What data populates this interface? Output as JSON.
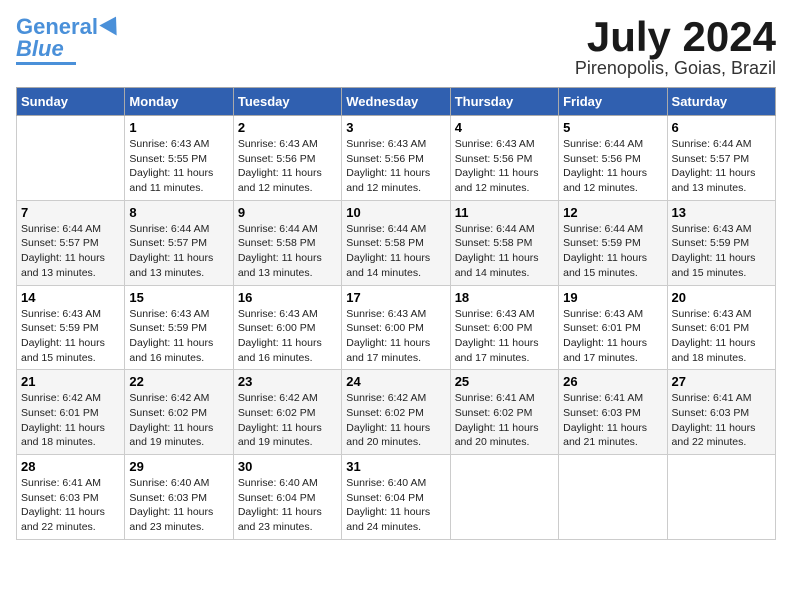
{
  "logo": {
    "line1": "General",
    "line2": "Blue"
  },
  "title": {
    "month": "July 2024",
    "location": "Pirenopolis, Goias, Brazil"
  },
  "weekdays": [
    "Sunday",
    "Monday",
    "Tuesday",
    "Wednesday",
    "Thursday",
    "Friday",
    "Saturday"
  ],
  "weeks": [
    [
      {
        "day": "",
        "info": ""
      },
      {
        "day": "1",
        "info": "Sunrise: 6:43 AM\nSunset: 5:55 PM\nDaylight: 11 hours\nand 11 minutes."
      },
      {
        "day": "2",
        "info": "Sunrise: 6:43 AM\nSunset: 5:56 PM\nDaylight: 11 hours\nand 12 minutes."
      },
      {
        "day": "3",
        "info": "Sunrise: 6:43 AM\nSunset: 5:56 PM\nDaylight: 11 hours\nand 12 minutes."
      },
      {
        "day": "4",
        "info": "Sunrise: 6:43 AM\nSunset: 5:56 PM\nDaylight: 11 hours\nand 12 minutes."
      },
      {
        "day": "5",
        "info": "Sunrise: 6:44 AM\nSunset: 5:56 PM\nDaylight: 11 hours\nand 12 minutes."
      },
      {
        "day": "6",
        "info": "Sunrise: 6:44 AM\nSunset: 5:57 PM\nDaylight: 11 hours\nand 13 minutes."
      }
    ],
    [
      {
        "day": "7",
        "info": "Sunrise: 6:44 AM\nSunset: 5:57 PM\nDaylight: 11 hours\nand 13 minutes."
      },
      {
        "day": "8",
        "info": "Sunrise: 6:44 AM\nSunset: 5:57 PM\nDaylight: 11 hours\nand 13 minutes."
      },
      {
        "day": "9",
        "info": "Sunrise: 6:44 AM\nSunset: 5:58 PM\nDaylight: 11 hours\nand 13 minutes."
      },
      {
        "day": "10",
        "info": "Sunrise: 6:44 AM\nSunset: 5:58 PM\nDaylight: 11 hours\nand 14 minutes."
      },
      {
        "day": "11",
        "info": "Sunrise: 6:44 AM\nSunset: 5:58 PM\nDaylight: 11 hours\nand 14 minutes."
      },
      {
        "day": "12",
        "info": "Sunrise: 6:44 AM\nSunset: 5:59 PM\nDaylight: 11 hours\nand 15 minutes."
      },
      {
        "day": "13",
        "info": "Sunrise: 6:43 AM\nSunset: 5:59 PM\nDaylight: 11 hours\nand 15 minutes."
      }
    ],
    [
      {
        "day": "14",
        "info": "Sunrise: 6:43 AM\nSunset: 5:59 PM\nDaylight: 11 hours\nand 15 minutes."
      },
      {
        "day": "15",
        "info": "Sunrise: 6:43 AM\nSunset: 5:59 PM\nDaylight: 11 hours\nand 16 minutes."
      },
      {
        "day": "16",
        "info": "Sunrise: 6:43 AM\nSunset: 6:00 PM\nDaylight: 11 hours\nand 16 minutes."
      },
      {
        "day": "17",
        "info": "Sunrise: 6:43 AM\nSunset: 6:00 PM\nDaylight: 11 hours\nand 17 minutes."
      },
      {
        "day": "18",
        "info": "Sunrise: 6:43 AM\nSunset: 6:00 PM\nDaylight: 11 hours\nand 17 minutes."
      },
      {
        "day": "19",
        "info": "Sunrise: 6:43 AM\nSunset: 6:01 PM\nDaylight: 11 hours\nand 17 minutes."
      },
      {
        "day": "20",
        "info": "Sunrise: 6:43 AM\nSunset: 6:01 PM\nDaylight: 11 hours\nand 18 minutes."
      }
    ],
    [
      {
        "day": "21",
        "info": "Sunrise: 6:42 AM\nSunset: 6:01 PM\nDaylight: 11 hours\nand 18 minutes."
      },
      {
        "day": "22",
        "info": "Sunrise: 6:42 AM\nSunset: 6:02 PM\nDaylight: 11 hours\nand 19 minutes."
      },
      {
        "day": "23",
        "info": "Sunrise: 6:42 AM\nSunset: 6:02 PM\nDaylight: 11 hours\nand 19 minutes."
      },
      {
        "day": "24",
        "info": "Sunrise: 6:42 AM\nSunset: 6:02 PM\nDaylight: 11 hours\nand 20 minutes."
      },
      {
        "day": "25",
        "info": "Sunrise: 6:41 AM\nSunset: 6:02 PM\nDaylight: 11 hours\nand 20 minutes."
      },
      {
        "day": "26",
        "info": "Sunrise: 6:41 AM\nSunset: 6:03 PM\nDaylight: 11 hours\nand 21 minutes."
      },
      {
        "day": "27",
        "info": "Sunrise: 6:41 AM\nSunset: 6:03 PM\nDaylight: 11 hours\nand 22 minutes."
      }
    ],
    [
      {
        "day": "28",
        "info": "Sunrise: 6:41 AM\nSunset: 6:03 PM\nDaylight: 11 hours\nand 22 minutes."
      },
      {
        "day": "29",
        "info": "Sunrise: 6:40 AM\nSunset: 6:03 PM\nDaylight: 11 hours\nand 23 minutes."
      },
      {
        "day": "30",
        "info": "Sunrise: 6:40 AM\nSunset: 6:04 PM\nDaylight: 11 hours\nand 23 minutes."
      },
      {
        "day": "31",
        "info": "Sunrise: 6:40 AM\nSunset: 6:04 PM\nDaylight: 11 hours\nand 24 minutes."
      },
      {
        "day": "",
        "info": ""
      },
      {
        "day": "",
        "info": ""
      },
      {
        "day": "",
        "info": ""
      }
    ]
  ]
}
